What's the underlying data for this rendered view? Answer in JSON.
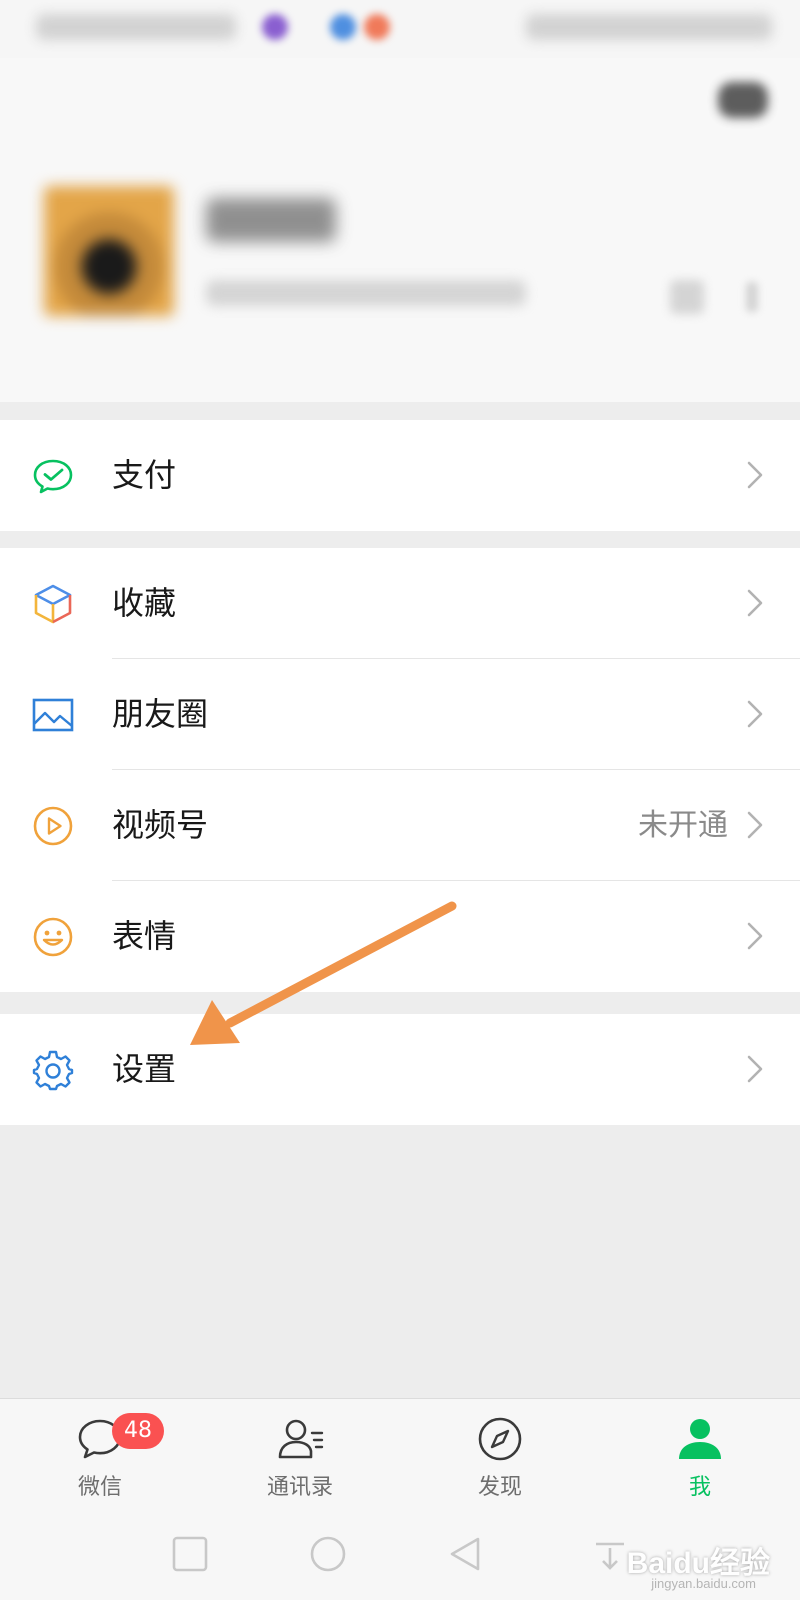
{
  "menu": {
    "pay": {
      "label": "支付",
      "icon": "wechat-pay-icon"
    },
    "items": [
      {
        "label": "收藏",
        "value": "",
        "icon": "favorites-cube-icon"
      },
      {
        "label": "朋友圈",
        "value": "",
        "icon": "moments-image-icon"
      },
      {
        "label": "视频号",
        "value": "未开通",
        "icon": "channels-play-icon"
      },
      {
        "label": "表情",
        "value": "",
        "icon": "sticker-smile-icon"
      }
    ],
    "settings": {
      "label": "设置",
      "icon": "gear-icon"
    }
  },
  "tabbar": {
    "tabs": [
      {
        "label": "微信",
        "badge": "48",
        "icon": "chat-bubble-icon"
      },
      {
        "label": "通讯录",
        "icon": "contacts-icon"
      },
      {
        "label": "发现",
        "icon": "compass-icon"
      },
      {
        "label": "我",
        "icon": "person-icon",
        "active": true
      }
    ]
  },
  "watermark": {
    "brand": "Baidu经验",
    "url": "jingyan.baidu.com"
  },
  "colors": {
    "accent": "#07c160",
    "badge": "#fa5151",
    "annotation_arrow": "#f0944a"
  }
}
